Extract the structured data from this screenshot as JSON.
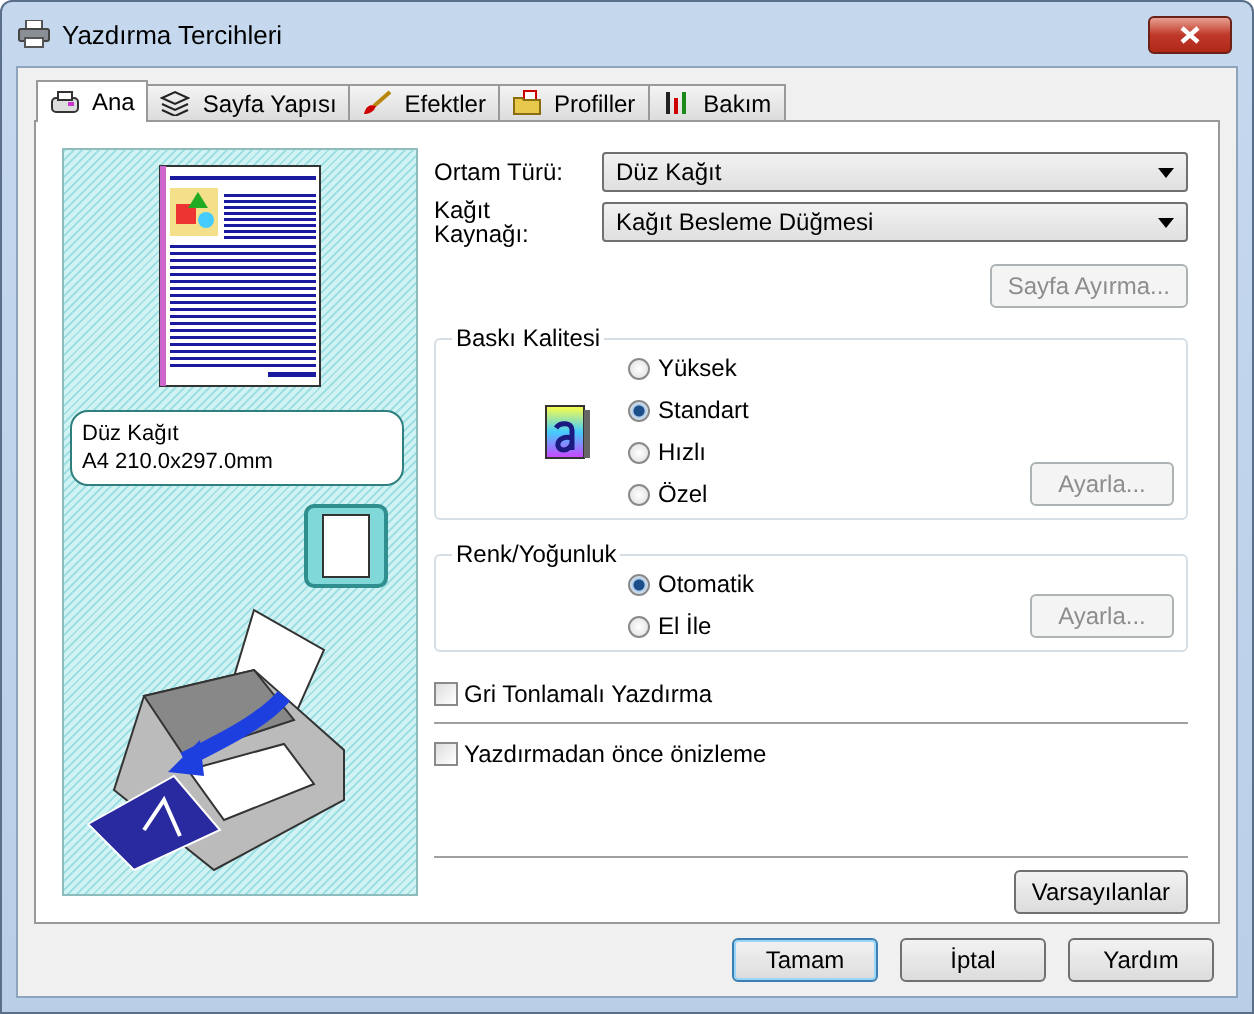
{
  "window": {
    "title": "Yazdırma Tercihleri"
  },
  "tabs": [
    {
      "label": "Ana",
      "selected": true,
      "kind": "main"
    },
    {
      "label": "Sayfa Yapısı",
      "selected": false,
      "kind": "layout"
    },
    {
      "label": "Efektler",
      "selected": false,
      "kind": "effects"
    },
    {
      "label": "Profiller",
      "selected": false,
      "kind": "profiles"
    },
    {
      "label": "Bakım",
      "selected": false,
      "kind": "maintenance"
    }
  ],
  "preview": {
    "media": "Düz Kağıt",
    "size": "A4 210.0x297.0mm"
  },
  "media_type": {
    "label": "Ortam Türü:",
    "value": "Düz Kağıt"
  },
  "paper_source": {
    "label": "Kağıt\nKaynağı:",
    "value": "Kağıt Besleme Düğmesi"
  },
  "page_separation_button": {
    "label": "Sayfa Ayırma...",
    "disabled": true
  },
  "print_quality": {
    "title": "Baskı Kalitesi",
    "options": [
      {
        "label": "Yüksek",
        "selected": false
      },
      {
        "label": "Standart",
        "selected": true
      },
      {
        "label": "Hızlı",
        "selected": false
      },
      {
        "label": "Özel",
        "selected": false
      }
    ],
    "button": {
      "label": "Ayarla...",
      "disabled": true
    }
  },
  "color_intensity": {
    "title": "Renk/Yoğunluk",
    "options": [
      {
        "label": "Otomatik",
        "selected": true
      },
      {
        "label": "El İle",
        "selected": false
      }
    ],
    "button": {
      "label": "Ayarla...",
      "disabled": true
    }
  },
  "grayscale": {
    "label": "Gri Tonlamalı Yazdırma",
    "checked": false
  },
  "preview_before_print": {
    "label": "Yazdırmadan önce önizleme",
    "checked": false
  },
  "defaults_button": "Varsayılanlar",
  "buttons": [
    {
      "label": "Tamam",
      "default": true
    },
    {
      "label": "İptal",
      "default": false
    },
    {
      "label": "Yardım",
      "default": false
    }
  ]
}
